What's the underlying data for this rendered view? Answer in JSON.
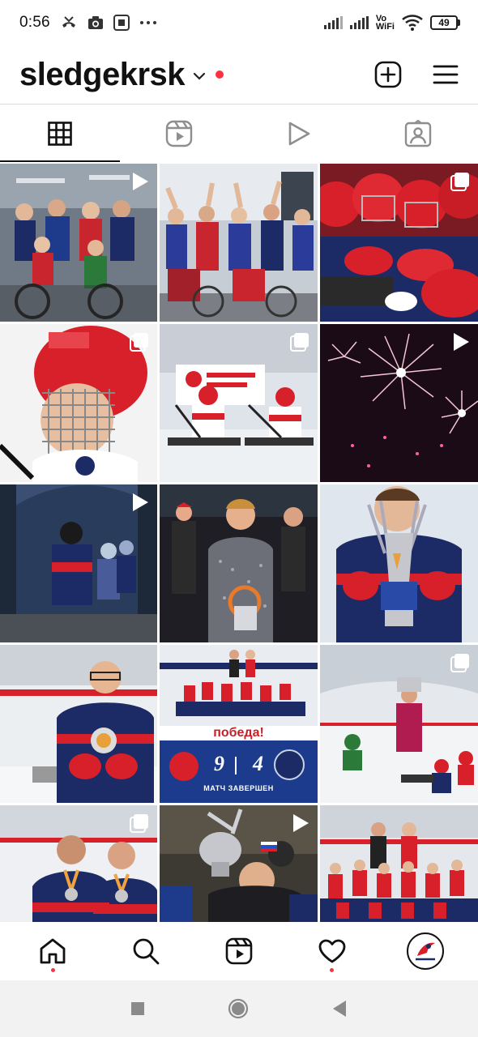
{
  "status_bar": {
    "time": "0:56",
    "network_label_top": "Vo",
    "network_label_bottom": "WiFi",
    "battery": "49"
  },
  "header": {
    "username": "sledgekrsk"
  },
  "tabs": [
    {
      "name": "grid",
      "icon": "grid-icon",
      "active": true
    },
    {
      "name": "reels",
      "icon": "reels-icon",
      "active": false
    },
    {
      "name": "videos",
      "icon": "play-icon",
      "active": false
    },
    {
      "name": "tagged",
      "icon": "tagged-icon",
      "active": false
    }
  ],
  "posts": [
    {
      "badge": "video",
      "scene": "group-wheelchairs"
    },
    {
      "badge": "none",
      "scene": "group-cheering"
    },
    {
      "badge": "multi",
      "scene": "helmets-huddle"
    },
    {
      "badge": "multi",
      "scene": "boy-helmet"
    },
    {
      "badge": "multi",
      "scene": "sledge-players"
    },
    {
      "badge": "video",
      "scene": "fireworks"
    },
    {
      "badge": "video",
      "scene": "evening-outdoor"
    },
    {
      "badge": "none",
      "scene": "boy-award"
    },
    {
      "badge": "none",
      "scene": "trophy-boy"
    },
    {
      "badge": "none",
      "scene": "boy-medal"
    },
    {
      "badge": "none",
      "scene": "victory-score",
      "banner": "победа!",
      "score_home": "9",
      "score_away": "4",
      "caption": "МАТЧ ЗАВЕРШЕН"
    },
    {
      "badge": "multi",
      "scene": "trophy-lift-rink"
    },
    {
      "badge": "multi",
      "scene": "two-boys-medals"
    },
    {
      "badge": "video",
      "scene": "trophy-celebration"
    },
    {
      "badge": "none",
      "scene": "team-photo"
    }
  ],
  "bottom_nav": [
    {
      "name": "home",
      "icon": "home-icon",
      "dot": true
    },
    {
      "name": "search",
      "icon": "search-icon",
      "dot": false
    },
    {
      "name": "reels",
      "icon": "reels-icon",
      "dot": false
    },
    {
      "name": "activity",
      "icon": "heart-icon",
      "dot": true
    },
    {
      "name": "profile",
      "icon": "avatar",
      "dot": false
    }
  ],
  "colors": {
    "notification": "#ff3040",
    "team_red": "#d8202a",
    "team_navy": "#1c2a66"
  }
}
